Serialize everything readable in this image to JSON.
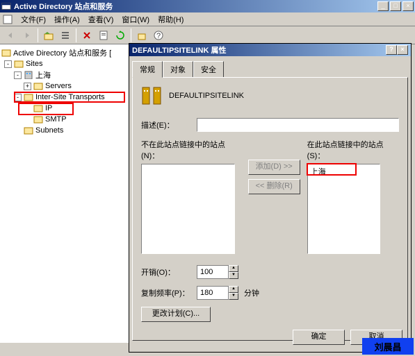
{
  "main": {
    "title": "Active Directory 站点和服务"
  },
  "menu": {
    "file": "文件(F)",
    "action": "操作(A)",
    "view": "查看(V)",
    "window": "窗口(W)",
    "help": "帮助(H)"
  },
  "tree": {
    "root": "Active Directory 站点和服务 [",
    "sites": "Sites",
    "shanghai": "上海",
    "servers": "Servers",
    "ist": "Inter-Site Transports",
    "ip": "IP",
    "smtp": "SMTP",
    "subnets": "Subnets"
  },
  "dialog": {
    "title": "DEFAULTIPSITELINK 属性",
    "tab_general": "常规",
    "tab_object": "对象",
    "tab_security": "安全",
    "name": "DEFAULTIPSITELINK",
    "desc_label": "描述(E)：",
    "desc_value": "",
    "not_in_label": "不在此站点链接中的站点(N)：",
    "in_label": "在此站点链接中的站点(S)：",
    "in_item": "上海",
    "add_btn": "添加(D) >>",
    "remove_btn": "<< 删除(R)",
    "cost_label": "开销(O)：",
    "cost_value": "100",
    "repl_label": "复制频率(P)：",
    "repl_value": "180",
    "repl_unit": "分钟",
    "schedule_btn": "更改计划(C)...",
    "ok": "确定",
    "cancel": "取消"
  },
  "stamp": "刘晨昌"
}
